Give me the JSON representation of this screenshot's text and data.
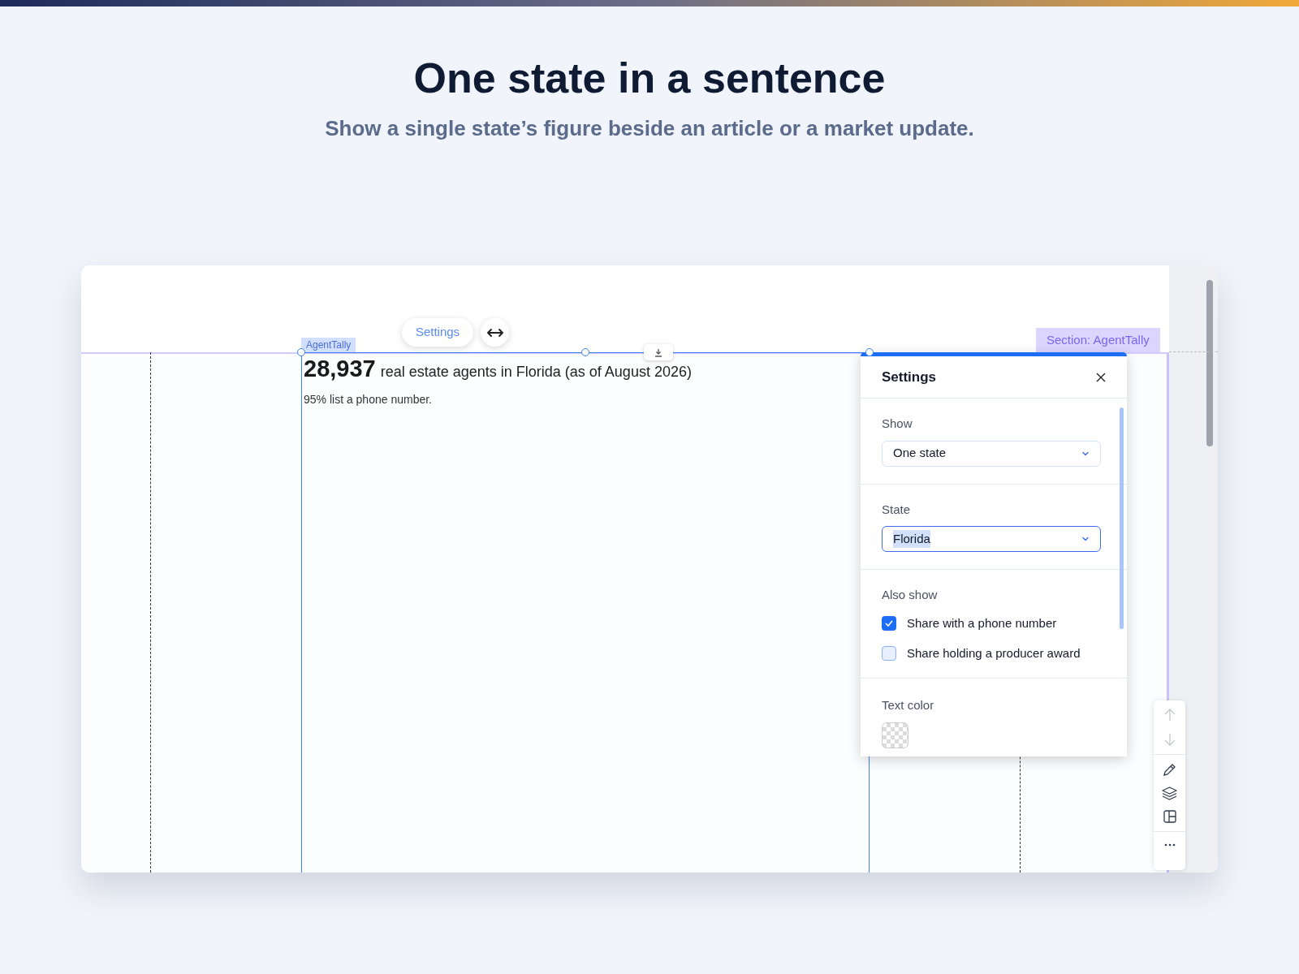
{
  "heading": "One state in a sentence",
  "subtitle": "Show a single state’s figure beside an article or a market update.",
  "editor": {
    "settings_button": "Settings",
    "widget_label": "AgentTally",
    "figure": "28,937",
    "headline": "real estate agents in Florida (as of August 2026)",
    "note": "95% list a phone number.",
    "section_label": "Section: AgentTally"
  },
  "settings_panel": {
    "title": "Settings",
    "fields": [
      {
        "label": "Show",
        "value": "One state",
        "focused": false
      },
      {
        "label": "State",
        "value": "Florida",
        "focused": true
      }
    ],
    "also_show": {
      "label": "Also show",
      "options": [
        {
          "label": "Share with a phone number",
          "checked": true
        },
        {
          "label": "Share holding a producer award",
          "checked": false
        }
      ]
    },
    "text_color": {
      "label": "Text color"
    }
  }
}
